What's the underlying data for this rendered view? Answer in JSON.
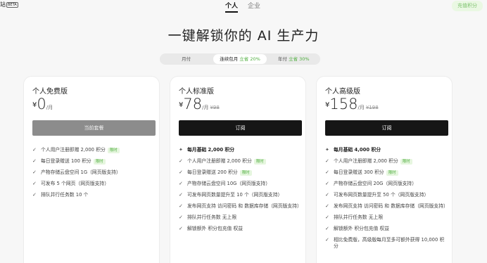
{
  "header": {
    "logo_text": "站",
    "beta": "BETA",
    "tabs": [
      {
        "label": "个人",
        "active": true
      },
      {
        "label": "企业",
        "active": false
      }
    ],
    "recharge": "充值积分"
  },
  "headline": "一键解锁你的 AI 生产力",
  "billing": {
    "options": [
      {
        "label": "月付",
        "discount": ""
      },
      {
        "label": "连续包月",
        "discount": "立省 20%"
      },
      {
        "label": "年付",
        "discount": "立省 30%"
      }
    ],
    "active_index": 1
  },
  "plans": [
    {
      "name": "个人免费版",
      "currency": "¥",
      "price": "0",
      "period": "/月",
      "original": "",
      "button": "当前套餐",
      "features": [
        {
          "text": "个人用户注册即赠 2,000 积分",
          "badge": "限时"
        },
        {
          "text": "每日登录赠送 100 积分",
          "badge": "限时"
        },
        {
          "text": "产物存储云盘空间 1G（网页版支持）",
          "badge": ""
        },
        {
          "text": "可发布 5 个网页（网页版支持）",
          "badge": ""
        },
        {
          "text": "排队并行任务数 10 个",
          "badge": ""
        }
      ]
    },
    {
      "name": "个人标准版",
      "currency": "¥",
      "price": "78",
      "period": "/月",
      "original": "¥98",
      "button": "订阅",
      "highlight": "每月基础 2,000 积分",
      "features": [
        {
          "text": "个人用户注册即赠 2,000 积分",
          "badge": "限时"
        },
        {
          "text": "每日登录赠送 200 积分",
          "badge": "限时"
        },
        {
          "text": "产物存储云盘空间 10G（网页版支持）",
          "badge": ""
        },
        {
          "text": "可发布网页数量提升至 10 个（网页版支持）",
          "badge": ""
        },
        {
          "text": "发布网页支持 访问密码 和 数据库存储（网页版支持）",
          "badge": ""
        },
        {
          "text": "排队并行任务数 无上限",
          "badge": ""
        },
        {
          "text": "解锁额外 积分包充值 权益",
          "badge": ""
        }
      ]
    },
    {
      "name": "个人高级版",
      "currency": "¥",
      "price": "158",
      "period": "/月",
      "original": "¥198",
      "button": "订阅",
      "highlight": "每月基础 4,000 积分",
      "features": [
        {
          "text": "个人用户注册即赠 2,000 积分",
          "badge": "限时"
        },
        {
          "text": "每日登录赠送 300 积分",
          "badge": "限时"
        },
        {
          "text": "产物存储云盘空间 20G（网页版支持）",
          "badge": ""
        },
        {
          "text": "可发布网页数量提升至 50 个（网页版支持）",
          "badge": ""
        },
        {
          "text": "发布网页支持 访问密码 和 数据库存储（网页版支持）",
          "badge": ""
        },
        {
          "text": "排队并行任务数 无上限",
          "badge": ""
        },
        {
          "text": "解锁额外 积分包充值 权益",
          "badge": ""
        },
        {
          "text": "相比免费版，高级版每月至多可额外获得 10,000 积分",
          "badge": ""
        }
      ]
    }
  ]
}
